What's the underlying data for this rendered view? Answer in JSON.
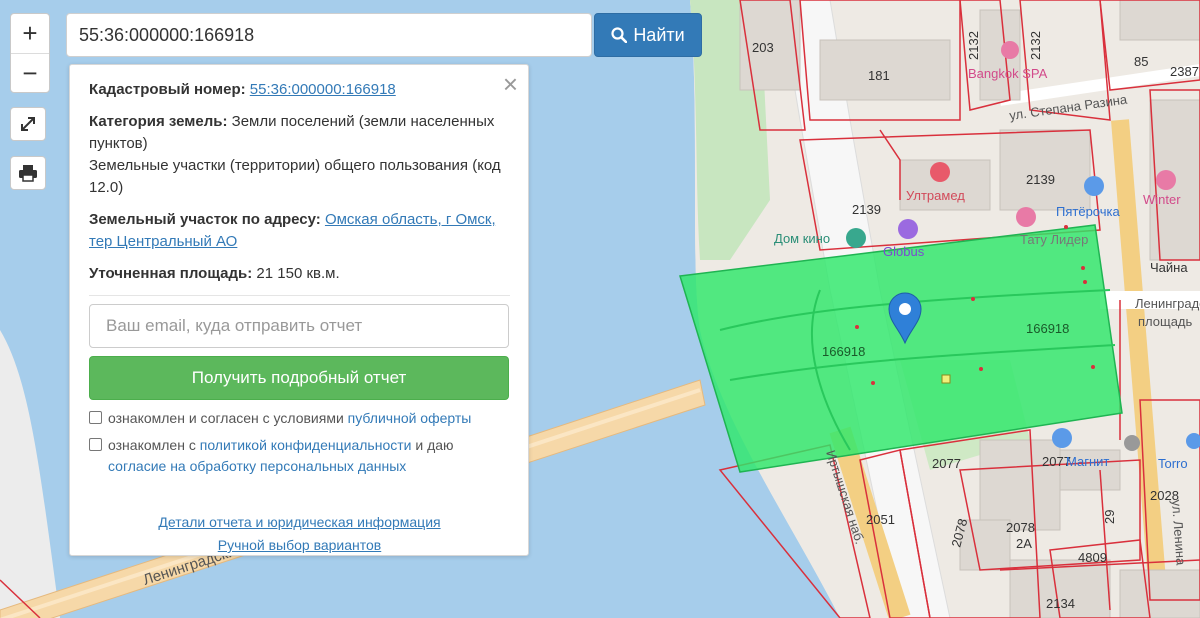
{
  "search": {
    "value": "55:36:000000:166918",
    "button_label": "Найти"
  },
  "controls": {
    "zoom_in": "+",
    "zoom_out": "−"
  },
  "panel": {
    "close": "×",
    "cadastral_label": "Кадастровый номер:",
    "cadastral_value": "55:36:000000:166918",
    "category_label": "Категория земель:",
    "category_value_1": "Земли поселений (земли населенных пунктов)",
    "category_value_2": "Земельные участки (территории) общего пользования (код 12.0)",
    "address_label": "Земельный участок по адресу:",
    "address_value": "Омская область, г Омск, тер Центральный АО",
    "area_label": "Уточненная площадь:",
    "area_value": "21 150 кв.м.",
    "email_placeholder": "Ваш email, куда отправить отчет",
    "report_button": "Получить подробный отчет",
    "consent1_text": "ознакомлен и согласен с условиями",
    "consent1_link": "публичной оферты",
    "consent2_text_a": "ознакомлен с",
    "consent2_link": "политикой конфиденциальности",
    "consent2_text_b": "и даю",
    "consent2_link2": "согласие на обработку персональных данных",
    "details_link": "Детали отчета и юридическая информация",
    "manual_link": "Ручной выбор вариантов"
  },
  "map": {
    "parcel_color": "#2ee86a",
    "parcel_labels": [
      "166918",
      "166918"
    ],
    "lot_numbers": [
      "203",
      "181",
      "2132",
      "2132",
      "85",
      "2387",
      "2139",
      "2139",
      "2077",
      "2077",
      "2078",
      "2078",
      "2051",
      "2028",
      "4809",
      "2134",
      "2А",
      "29"
    ],
    "street_labels": [
      "ул. Степана Разина",
      "Ленинградская площадь",
      "Иртышская наб.",
      "ул. Ленина",
      "Ленинградский"
    ],
    "poi_labels": [
      "Bangkok SPA",
      "Ултрамед",
      "Пятёрочка",
      "Дом кино",
      "Globus",
      "Тату Лидер",
      "Winter",
      "Чайна",
      "Магнит",
      "Torro"
    ],
    "marker": "map-marker"
  }
}
